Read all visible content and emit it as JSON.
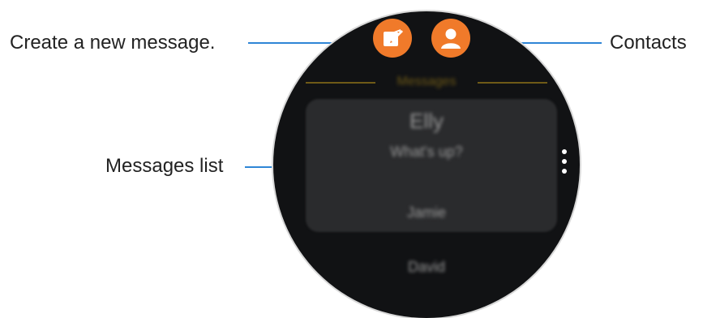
{
  "annotations": {
    "create": "Create a new message.",
    "contacts": "Contacts",
    "messages_list": "Messages list"
  },
  "watch": {
    "header_title": "Messages",
    "conversations": [
      {
        "name": "Elly",
        "preview": "What's up?"
      },
      {
        "name": "Jamie"
      },
      {
        "name": "David"
      }
    ]
  },
  "colors": {
    "accent": "#f07a2a",
    "callout": "#2f86d6",
    "header": "#6f5a17"
  },
  "icons": {
    "compose": "compose-icon",
    "contacts": "person-icon",
    "more": "more-vertical-icon"
  }
}
